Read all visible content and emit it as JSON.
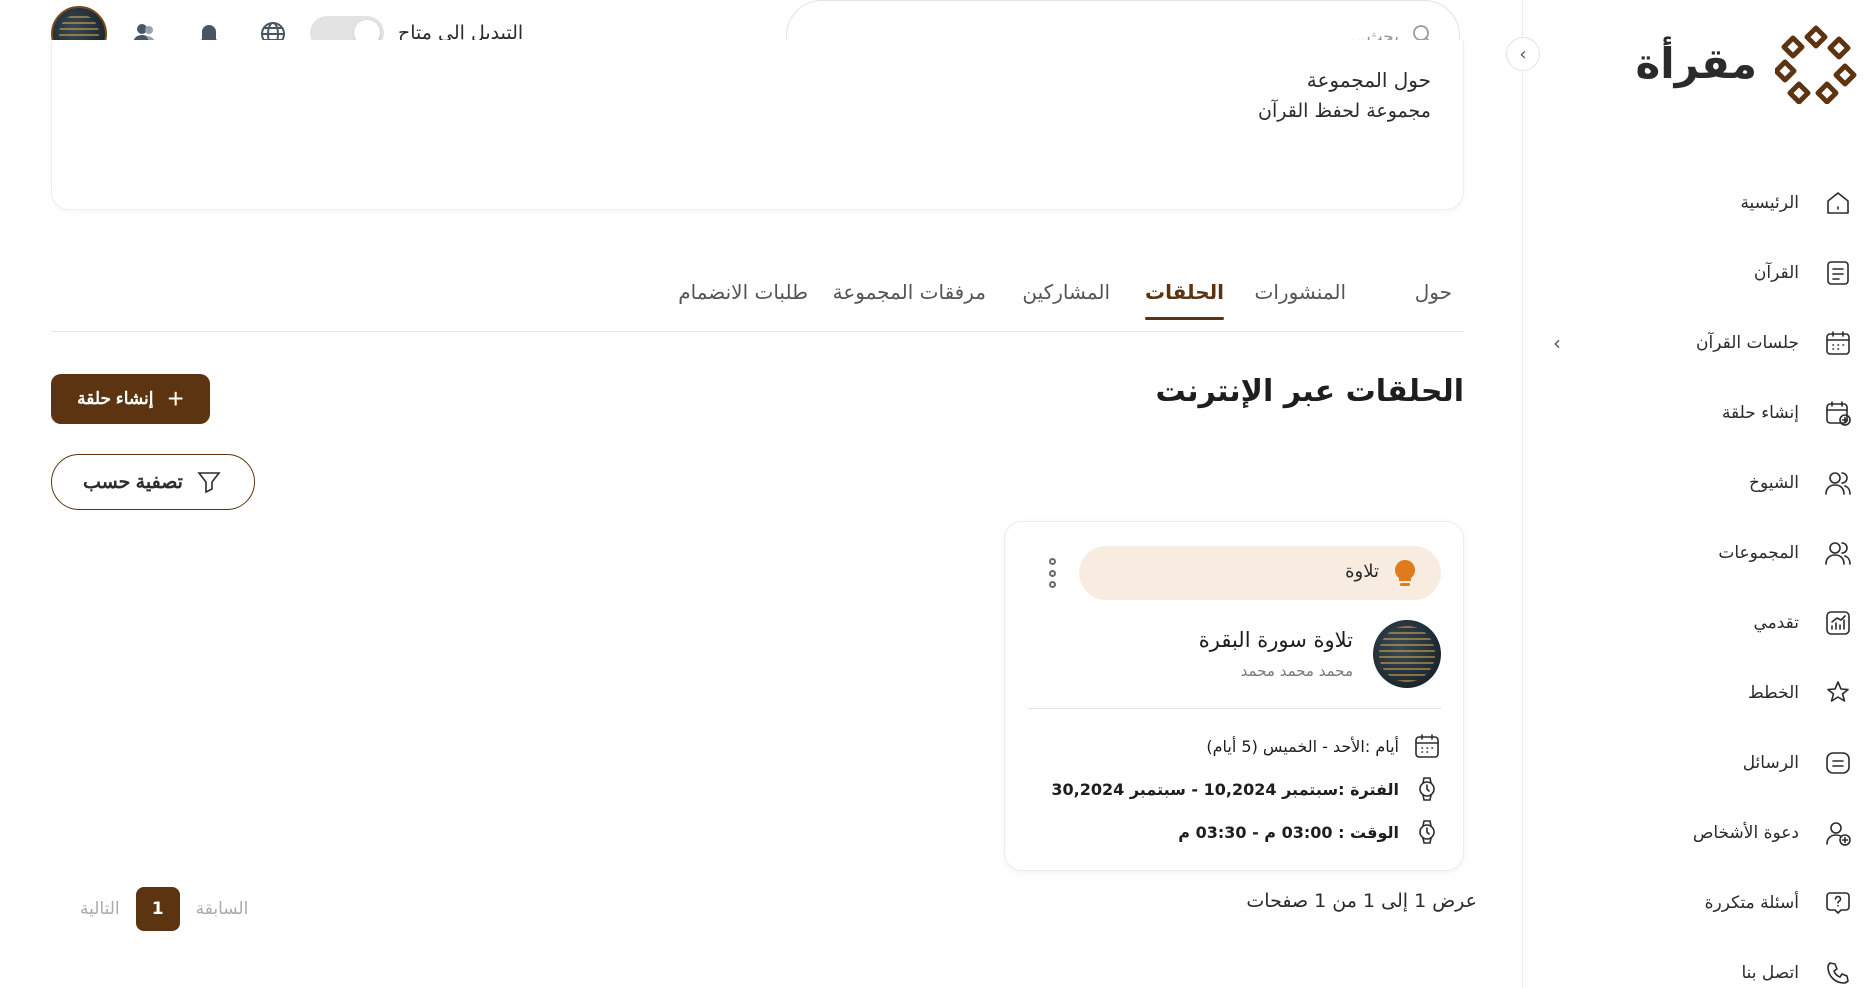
{
  "brand": {
    "name": "مقرأة",
    "color": "#5c3412"
  },
  "sidebar": {
    "items": [
      {
        "label": "الرئيسية",
        "icon": "home-icon"
      },
      {
        "label": "القرآن",
        "icon": "book-icon"
      },
      {
        "label": "جلسات القرآن",
        "icon": "calendar-icon",
        "has_submenu": true
      },
      {
        "label": "إنشاء حلقة",
        "icon": "calendar-plus-icon"
      },
      {
        "label": "الشيوخ",
        "icon": "users-icon"
      },
      {
        "label": "المجموعات",
        "icon": "group-icon"
      },
      {
        "label": "تقدمي",
        "icon": "chart-icon"
      },
      {
        "label": "الخطط",
        "icon": "star-icon"
      },
      {
        "label": "الرسائل",
        "icon": "message-icon"
      },
      {
        "label": "دعوة الأشخاص",
        "icon": "user-plus-icon"
      },
      {
        "label": "أسئلة متكررة",
        "icon": "help-icon"
      },
      {
        "label": "اتصل بنا",
        "icon": "phone-icon"
      }
    ]
  },
  "topbar": {
    "search_placeholder": "بحث...",
    "toggle_label": "التبديل إلى متاح",
    "toggle_on": false
  },
  "about": {
    "title": "حول المجموعة",
    "text": "مجموعة لحفظ القرآن"
  },
  "tabs": [
    {
      "label": "حول",
      "active": false
    },
    {
      "label": "المنشورات",
      "active": false
    },
    {
      "label": "الحلقات",
      "active": true
    },
    {
      "label": "المشاركين",
      "active": false
    },
    {
      "label": "مرفقات المجموعة",
      "active": false
    },
    {
      "label": "طلبات الانضمام",
      "active": false
    }
  ],
  "section": {
    "title": "الحلقات عبر الإنترنت",
    "create_label": "إنشاء حلقة",
    "filter_label": "تصفية حسب"
  },
  "circle_card": {
    "tag": "تلاوة",
    "tag_color": "#e07a1f",
    "title": "تلاوة سورة البقرة",
    "teacher": "محمد محمد محمد",
    "days": "أيام :الأحد - الخميس (5 أيام)",
    "period": "الفترة :سبتمبر 10,2024 - سبتمبر 30,2024",
    "time": "الوقت : 03:00 م - 03:30 م"
  },
  "pagination": {
    "info": "عرض 1 إلى 1 من 1 صفحات",
    "prev": "السابقة",
    "current": "1",
    "next": "التالية"
  }
}
